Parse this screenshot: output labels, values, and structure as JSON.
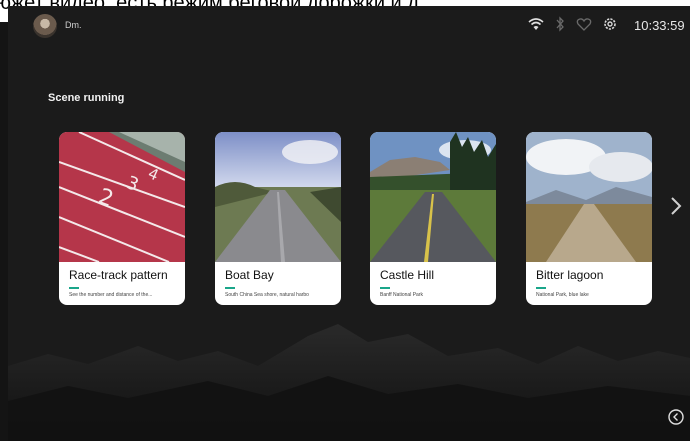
{
  "banner": {
    "text": "южет видео, есть режим беговой дорожки и д"
  },
  "status": {
    "username": "Dm.",
    "time": "10:33:59",
    "icons": [
      "wifi-icon",
      "bluetooth-icon",
      "heart-rate-icon",
      "settings-icon"
    ]
  },
  "section": {
    "title": "Scene running"
  },
  "cards": [
    {
      "title": "Race-track pattern",
      "description": "See the number and distance of the..."
    },
    {
      "title": "Boat Bay",
      "description": "South China Sea shore, natural harbo"
    },
    {
      "title": "Castle Hill",
      "description": "Banff National Park"
    },
    {
      "title": "Bitter lagoon",
      "description": "National Park, blue lake"
    }
  ],
  "colors": {
    "accent": "#1aa68a",
    "track": "#b5364a",
    "background": "#1b1b1b"
  }
}
